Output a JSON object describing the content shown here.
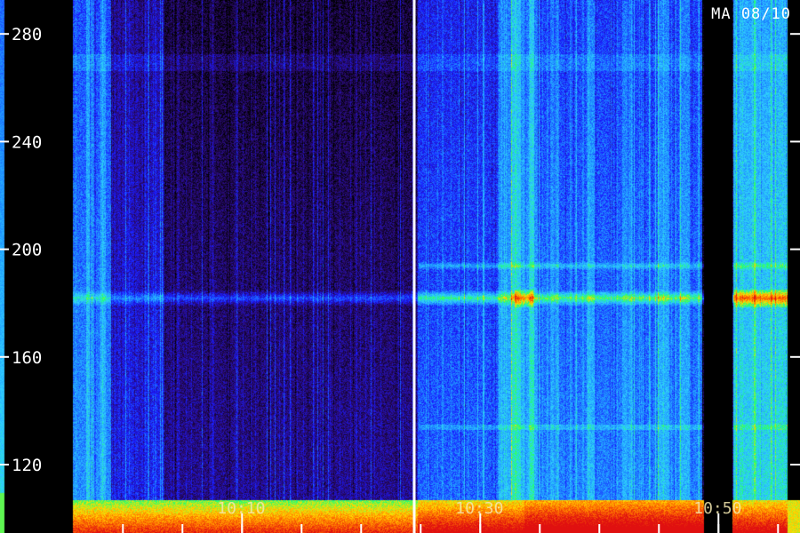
{
  "chart_data": {
    "type": "heatmap",
    "title": "MA 08/10",
    "xlabel": "",
    "ylabel": "",
    "x_ticks": [
      {
        "label": "10:10",
        "t": 10.1667
      },
      {
        "label": "10:30",
        "t": 10.5
      },
      {
        "label": "10:50",
        "t": 10.8333
      }
    ],
    "y_ticks": [
      120,
      160,
      200,
      240,
      280
    ],
    "y_range": [
      103,
      298
    ],
    "x_range_hours": [
      9.93,
      10.93
    ],
    "colormap": [
      "#000000",
      "#2a0a6b",
      "#1a1aff",
      "#1e8cff",
      "#30d0ff",
      "#20ff70",
      "#ffe000",
      "#ff7000",
      "#e01010"
    ],
    "features": [
      {
        "kind": "horizontal_band",
        "freq": 182,
        "intensity": "bright"
      },
      {
        "kind": "horizontal_band",
        "freq": 194,
        "intensity": "medium"
      },
      {
        "kind": "horizontal_band",
        "freq": 134,
        "intensity": "faint"
      },
      {
        "kind": "low_frequency_band",
        "freq_max": 107,
        "intensity": "very_bright"
      },
      {
        "kind": "data_gap",
        "t_start": 10.84,
        "t_end": 10.865
      },
      {
        "kind": "marker_line",
        "t": 10.51
      }
    ]
  }
}
